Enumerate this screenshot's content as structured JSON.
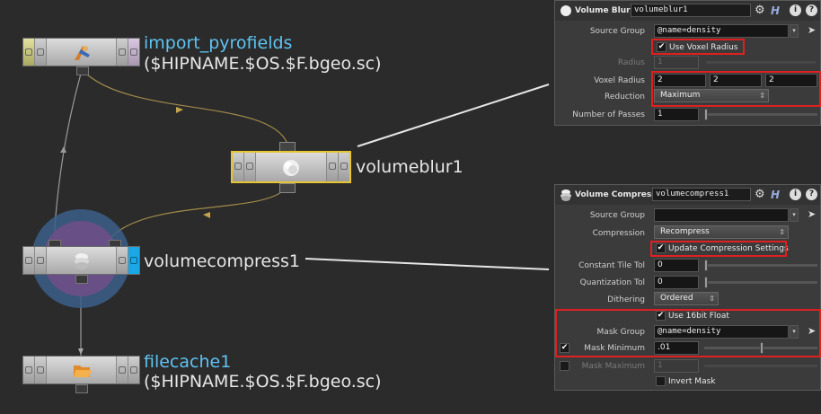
{
  "network": {
    "nodes": {
      "import": {
        "name": "import_pyrofields",
        "path": "($HIPNAME.$OS.$F.bgeo.sc)"
      },
      "blur": {
        "name": "volumeblur1"
      },
      "compress": {
        "name": "volumecompress1"
      },
      "cache": {
        "name": "filecache1",
        "path": "($HIPNAME.$OS.$F.bgeo.sc)"
      }
    }
  },
  "blur_panel": {
    "type": "Volume Blur",
    "name": "volumeblur1",
    "help_h": "H",
    "help_i": "i",
    "help_q": "?",
    "source_group_label": "Source Group",
    "source_group_value": "@name=density",
    "use_voxel_radius_label": "Use Voxel Radius",
    "use_voxel_radius": true,
    "radius_label": "Radius",
    "radius_value": "1",
    "voxel_radius_label": "Voxel Radius",
    "voxel_radius": [
      "2",
      "2",
      "2"
    ],
    "reduction_label": "Reduction",
    "reduction_value": "Maximum",
    "passes_label": "Number of Passes",
    "passes_value": "1",
    "passes_slider": 0.0
  },
  "compress_panel": {
    "type": "Volume Compress",
    "name": "volumecompress1",
    "help_h": "H",
    "help_i": "i",
    "help_q": "?",
    "source_group_label": "Source Group",
    "source_group_value": "",
    "compression_label": "Compression",
    "compression_value": "Recompress",
    "update_label": "Update Compression Settings",
    "update_checked": true,
    "tile_tol_label": "Constant Tile Tol",
    "tile_tol_value": "0",
    "quant_tol_label": "Quantization Tol",
    "quant_tol_value": "0",
    "dithering_label": "Dithering",
    "dithering_value": "Ordered",
    "float16_label": "Use 16bit Float",
    "float16_checked": true,
    "mask_group_label": "Mask Group",
    "mask_group_value": "@name=density",
    "mask_min_label": "Mask Minimum",
    "mask_min_enabled": true,
    "mask_min_value": ".01",
    "mask_min_slider": 0.6,
    "mask_max_label": "Mask Maximum",
    "mask_max_enabled": false,
    "mask_max_value": "1",
    "invert_mask_label": "Invert Mask",
    "invert_mask_checked": false
  },
  "colors": {
    "selection": "#e6c531",
    "highlight": "#e02020",
    "node_label": "#5ec3f2",
    "display_flag": "#1aa7e6",
    "wire": "#a08a4a"
  }
}
